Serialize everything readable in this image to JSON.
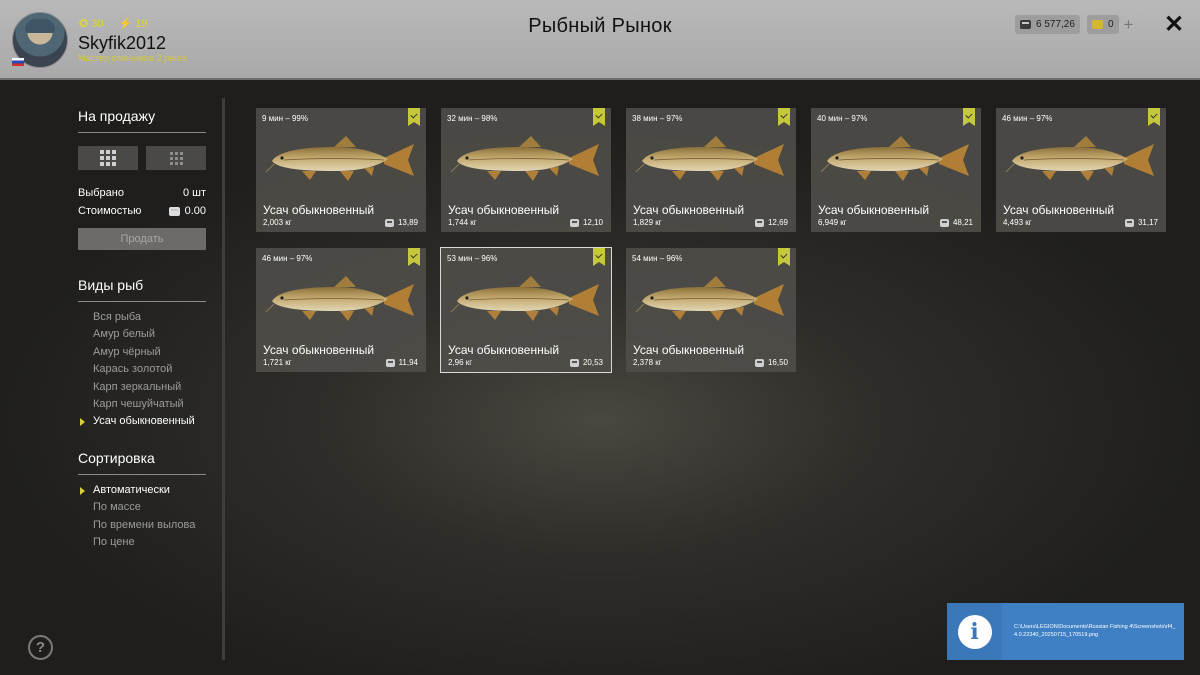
{
  "player": {
    "stat_coins": "30",
    "stat_energy": "19",
    "username": "Skyfik2012",
    "rank": "Мастер спиннинга 2 ранга"
  },
  "header": {
    "title": "Рыбный Рынок",
    "silver": "6 577,26",
    "gold": "0",
    "plus": "+",
    "close": "✕"
  },
  "sidebar": {
    "for_sale_title": "На продажу",
    "selected_label": "Выбрано",
    "selected_value": "0 шт",
    "cost_label": "Стоимостью",
    "cost_value": "0.00",
    "sell_button": "Продать",
    "species_title": "Виды рыб",
    "species": [
      {
        "label": "Вся рыба",
        "active": false
      },
      {
        "label": "Амур белый",
        "active": false
      },
      {
        "label": "Амур чёрный",
        "active": false
      },
      {
        "label": "Карась золотой",
        "active": false
      },
      {
        "label": "Карп зеркальный",
        "active": false
      },
      {
        "label": "Карп чешуйчатый",
        "active": false
      },
      {
        "label": "Усач обыкновенный",
        "active": true
      }
    ],
    "sort_title": "Сортировка",
    "sort": [
      {
        "label": "Автоматически",
        "active": true
      },
      {
        "label": "По массе",
        "active": false
      },
      {
        "label": "По времени вылова",
        "active": false
      },
      {
        "label": "По цене",
        "active": false
      }
    ],
    "help": "?"
  },
  "cards": [
    {
      "meta": "9 мин – 99%",
      "name": "Усач обыкновенный",
      "weight": "2,003 кг",
      "price": "13,89",
      "selected": false
    },
    {
      "meta": "32 мин – 98%",
      "name": "Усач обыкновенный",
      "weight": "1,744 кг",
      "price": "12,10",
      "selected": false
    },
    {
      "meta": "38 мин – 97%",
      "name": "Усач обыкновенный",
      "weight": "1,829 кг",
      "price": "12,69",
      "selected": false
    },
    {
      "meta": "40 мин – 97%",
      "name": "Усач обыкновенный",
      "weight": "6,949 кг",
      "price": "48,21",
      "selected": false
    },
    {
      "meta": "46 мин – 97%",
      "name": "Усач обыкновенный",
      "weight": "4,493 кг",
      "price": "31,17",
      "selected": false
    },
    {
      "meta": "46 мин – 97%",
      "name": "Усач обыкновенный",
      "weight": "1,721 кг",
      "price": "11,94",
      "selected": false
    },
    {
      "meta": "53 мин – 96%",
      "name": "Усач обыкновенный",
      "weight": "2,96 кг",
      "price": "20,53",
      "selected": true
    },
    {
      "meta": "54 мин – 96%",
      "name": "Усач обыкновенный",
      "weight": "2,378 кг",
      "price": "16,50",
      "selected": false
    }
  ],
  "notification": {
    "icon": "i",
    "text": "C:\\Users\\LEGION\\Documents\\Russian Fishing 4\\Screenshots\\rf4_4.0.22340_20250715_170519.png"
  }
}
